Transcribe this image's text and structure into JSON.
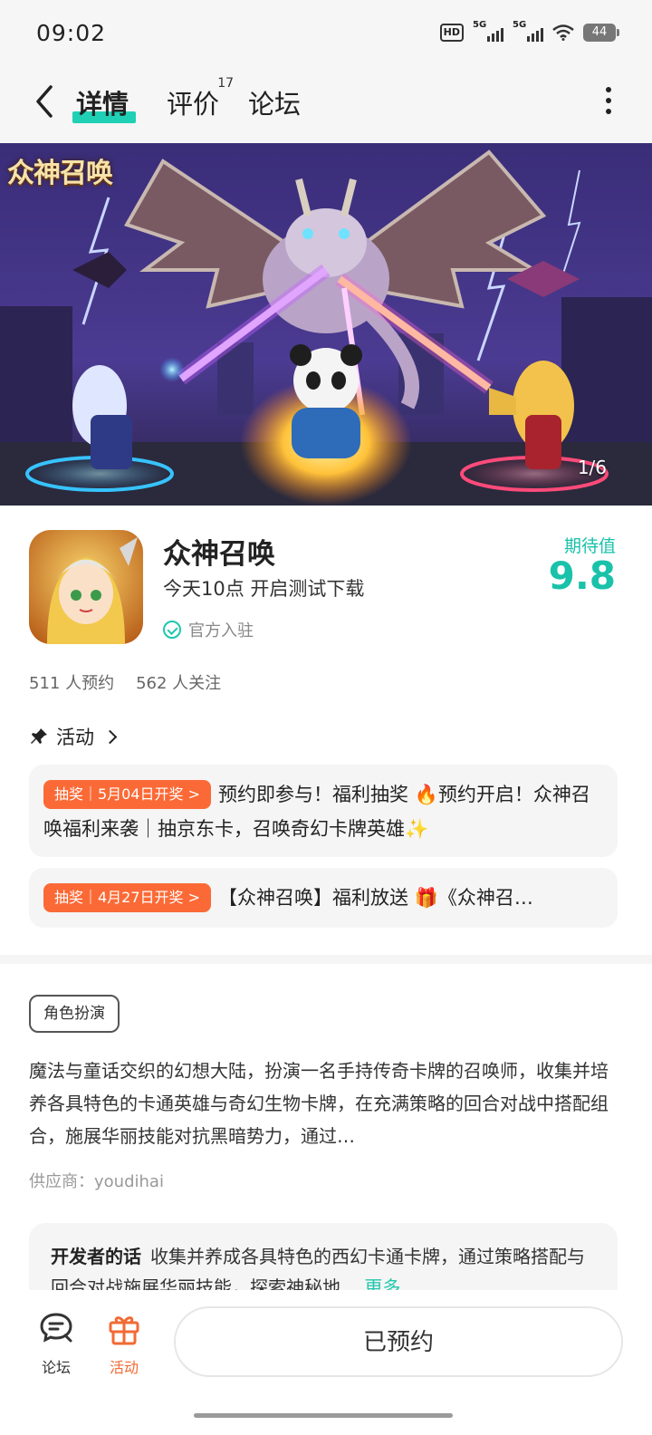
{
  "status": {
    "time": "09:02",
    "hd_label": "HD",
    "signal1_label": "5G",
    "signal2_label": "5G",
    "battery": "44"
  },
  "nav": {
    "tabs": [
      {
        "label": "详情"
      },
      {
        "label": "评价",
        "badge": "17"
      },
      {
        "label": "论坛"
      }
    ]
  },
  "banner": {
    "logo": "众神召唤",
    "counter": "1/6"
  },
  "app": {
    "name": "众神召唤",
    "subtitle": "今天10点 开启测试下载",
    "official": "官方入驻",
    "expect_label": "期待值",
    "expect_value": "9.8"
  },
  "stats": {
    "reservations": "511 人预约",
    "followers": "562 人关注"
  },
  "activity": {
    "title": "活动",
    "items": [
      {
        "badge": "抽奖｜5月04日开奖 >",
        "text": "预约即参与！福利抽奖 🔥预约开启！众神召唤福利来袭｜抽京东卡，召唤奇幻卡牌英雄✨"
      },
      {
        "badge": "抽奖｜4月27日开奖 >",
        "text": "【众神召唤】福利放送 🎁《众神召…"
      }
    ]
  },
  "detail": {
    "tag": "角色扮演",
    "description": "魔法与童话交织的幻想大陆，扮演一名手持传奇卡牌的召唤师，收集并培养各具特色的卡通英雄与奇幻生物卡牌，在充满策略的回合对战中搭配组合，施展华丽技能对抗黑暗势力，通过…",
    "vendor": "供应商：youdihai",
    "dev_label": "开发者的话",
    "dev_text": "收集并养成各具特色的西幻卡通卡牌，通过策略搭配与回合对战施展华丽技能，探索神秘地…",
    "dev_more": "更多"
  },
  "bottom": {
    "forum": "论坛",
    "activity": "活动",
    "reserve": "已预约"
  },
  "colors": {
    "accent": "#1fd0b5",
    "badge": "#fb6a36",
    "activity_tab": "#f26a34"
  }
}
